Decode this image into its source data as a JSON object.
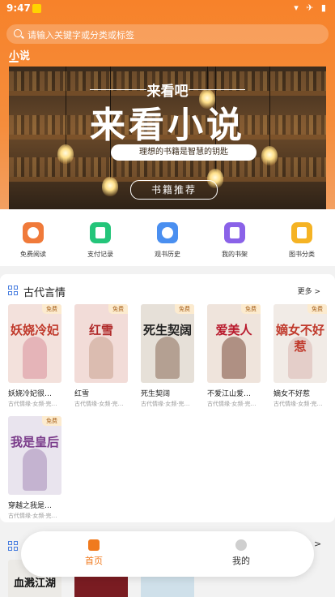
{
  "status_bar": {
    "time": "9:47",
    "icons": "▾ ✈ ▮"
  },
  "search": {
    "placeholder": "请输入关键字或分类或标签"
  },
  "category_tab": {
    "label": "小说"
  },
  "banner": {
    "small_text": "来看吧",
    "big_text": "来看小说",
    "slogan": "理想的书籍是智慧的钥匙",
    "button_label": "书籍推荐"
  },
  "quick_menu": [
    {
      "label": "免费阅读",
      "icon": "coin-icon",
      "color": "#f07a3a"
    },
    {
      "label": "支付记录",
      "icon": "document-icon",
      "color": "#24c57a"
    },
    {
      "label": "观书历史",
      "icon": "clock-icon",
      "color": "#4a8ff0"
    },
    {
      "label": "我的书架",
      "icon": "bookshelf-icon",
      "color": "#8a62e8"
    },
    {
      "label": "图书分类",
      "icon": "folder-icon",
      "color": "#f5b324"
    }
  ],
  "section": {
    "title": "古代言情",
    "more_label": "更多 >",
    "books": [
      {
        "title": "妖娆冷妃很…",
        "meta": "古代情缘·女频·完…",
        "badge": "免费",
        "cover_text": "妖娆冷妃",
        "cover_bg": "#f3e1dc",
        "cover_color": "#c0392b"
      },
      {
        "title": "红雪",
        "meta": "古代情缘·女频·完…",
        "badge": "免费",
        "cover_text": "红雪",
        "cover_bg": "#f2dcd8",
        "cover_color": "#b02a2a"
      },
      {
        "title": "死生契阔",
        "meta": "古代情缘·女频·完…",
        "badge": "免费",
        "cover_text": "死生契阔",
        "cover_bg": "#e6e0d8",
        "cover_color": "#222222"
      },
      {
        "title": "不爱江山爱…",
        "meta": "古代情缘·女频·完…",
        "badge": "免费",
        "cover_text": "爱美人",
        "cover_bg": "#efe4dc",
        "cover_color": "#b8182b"
      },
      {
        "title": "嫡女不好惹",
        "meta": "古代情缘·女频·完…",
        "badge": "免费",
        "cover_text": "嫡女不好惹",
        "cover_bg": "#f1ebe6",
        "cover_color": "#c0392b"
      },
      {
        "title": "穿越之我是…",
        "meta": "古代情缘·女频·完…",
        "badge": "免费",
        "cover_text": "我是皇后",
        "cover_bg": "#e9e4ee",
        "cover_color": "#7a3b8a"
      }
    ]
  },
  "next_section_peek": {
    "book_cover_text": "血溅江湖"
  },
  "tab_bar": {
    "home_label": "首页",
    "mine_label": "我的",
    "active_color": "#f07a1e"
  }
}
